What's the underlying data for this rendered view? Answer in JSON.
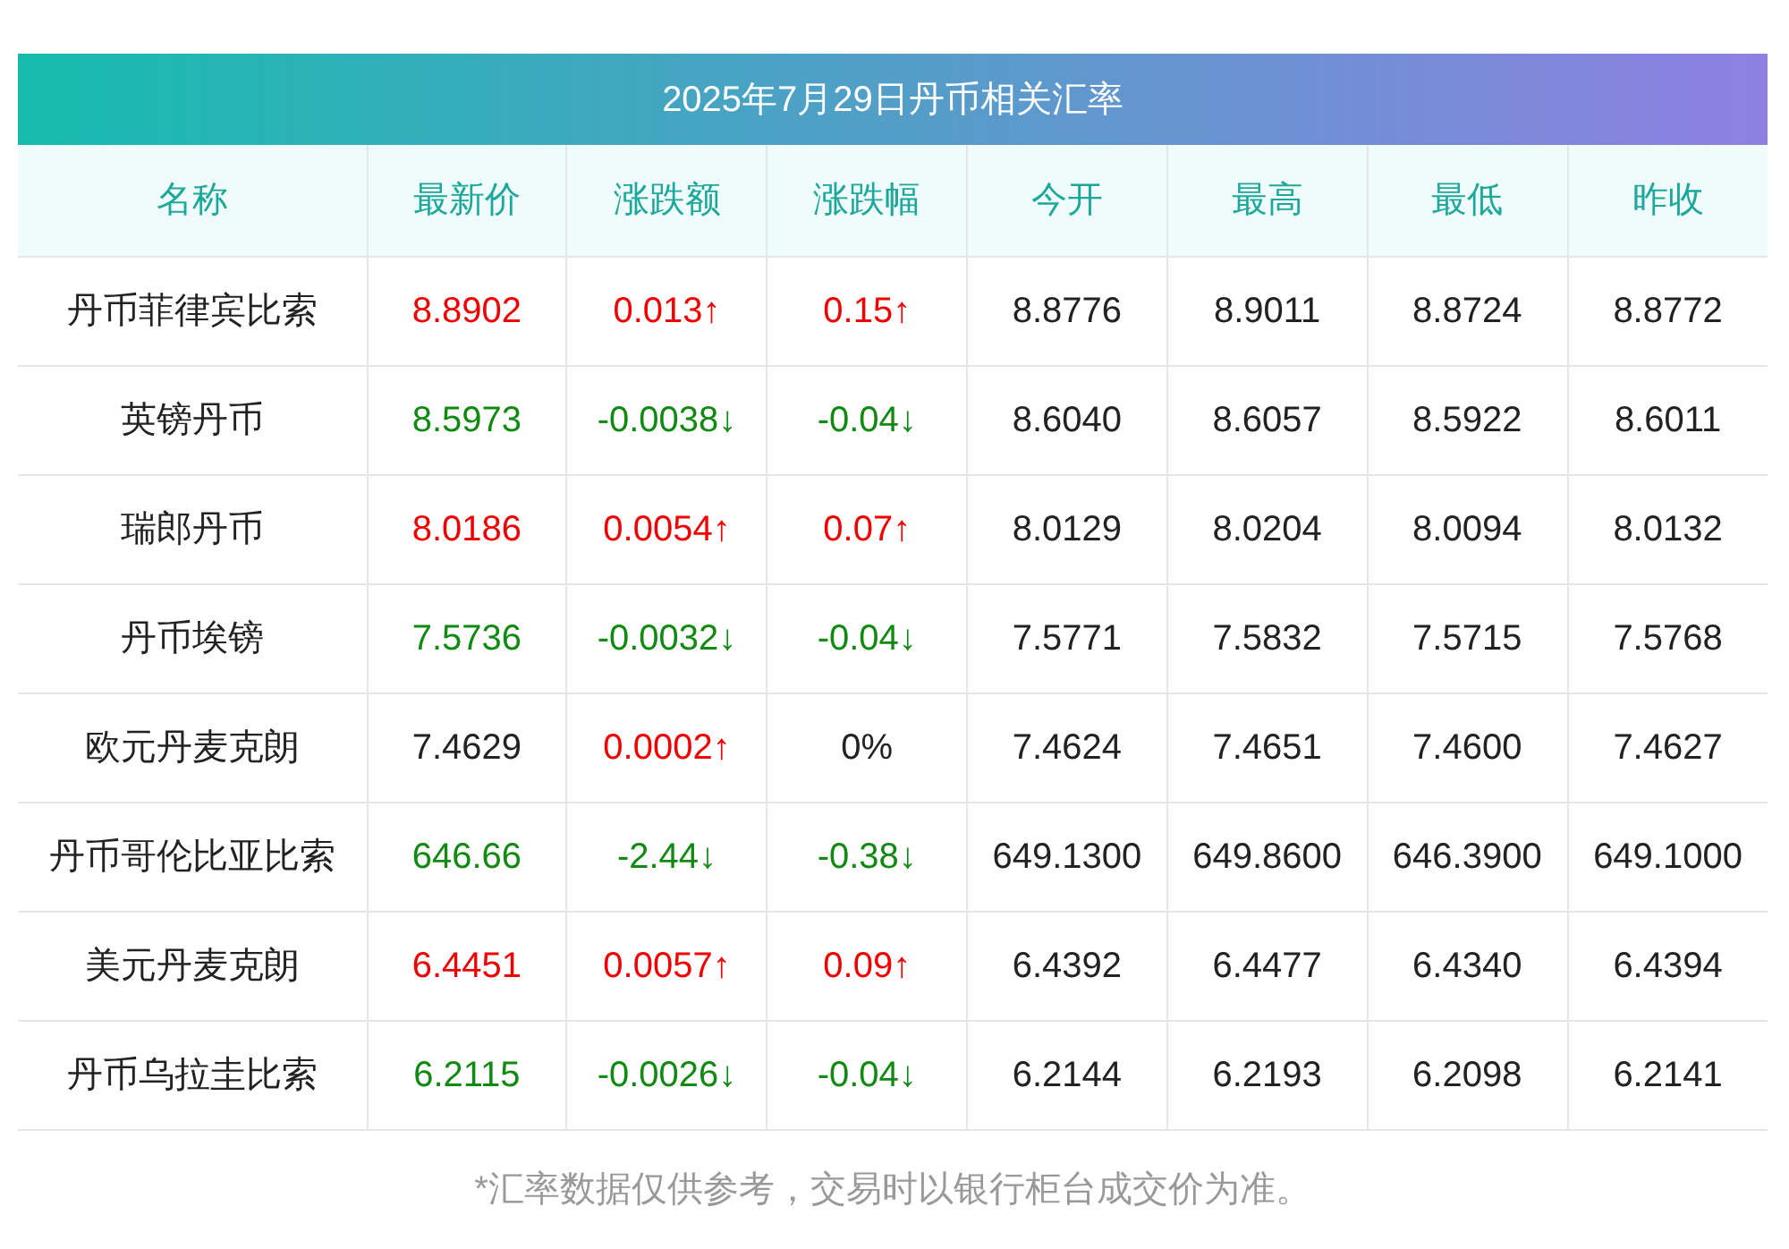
{
  "title": "2025年7月29日丹币相关汇率",
  "columns": [
    "名称",
    "最新价",
    "涨跌额",
    "涨跌幅",
    "今开",
    "最高",
    "最低",
    "昨收"
  ],
  "rows": [
    {
      "name": "丹币菲律宾比索",
      "price": {
        "text": "8.8902",
        "kind": "up"
      },
      "change": {
        "text": "0.013↑",
        "kind": "up"
      },
      "pct": {
        "text": "0.15↑",
        "kind": "up"
      },
      "open": "8.8776",
      "high": "8.9011",
      "low": "8.8724",
      "prev_close": "8.8772"
    },
    {
      "name": "英镑丹币",
      "price": {
        "text": "8.5973",
        "kind": "down"
      },
      "change": {
        "text": "-0.0038↓",
        "kind": "down"
      },
      "pct": {
        "text": "-0.04↓",
        "kind": "down"
      },
      "open": "8.6040",
      "high": "8.6057",
      "low": "8.5922",
      "prev_close": "8.6011"
    },
    {
      "name": "瑞郎丹币",
      "price": {
        "text": "8.0186",
        "kind": "up"
      },
      "change": {
        "text": "0.0054↑",
        "kind": "up"
      },
      "pct": {
        "text": "0.07↑",
        "kind": "up"
      },
      "open": "8.0129",
      "high": "8.0204",
      "low": "8.0094",
      "prev_close": "8.0132"
    },
    {
      "name": "丹币埃镑",
      "price": {
        "text": "7.5736",
        "kind": "down"
      },
      "change": {
        "text": "-0.0032↓",
        "kind": "down"
      },
      "pct": {
        "text": "-0.04↓",
        "kind": "down"
      },
      "open": "7.5771",
      "high": "7.5832",
      "low": "7.5715",
      "prev_close": "7.5768"
    },
    {
      "name": "欧元丹麦克朗",
      "price": {
        "text": "7.4629",
        "kind": "flat"
      },
      "change": {
        "text": "0.0002↑",
        "kind": "up"
      },
      "pct": {
        "text": "0%",
        "kind": "flat"
      },
      "open": "7.4624",
      "high": "7.4651",
      "low": "7.4600",
      "prev_close": "7.4627"
    },
    {
      "name": "丹币哥伦比亚比索",
      "price": {
        "text": "646.66",
        "kind": "down"
      },
      "change": {
        "text": "-2.44↓",
        "kind": "down"
      },
      "pct": {
        "text": "-0.38↓",
        "kind": "down"
      },
      "open": "649.1300",
      "high": "649.8600",
      "low": "646.3900",
      "prev_close": "649.1000"
    },
    {
      "name": "美元丹麦克朗",
      "price": {
        "text": "6.4451",
        "kind": "up"
      },
      "change": {
        "text": "0.0057↑",
        "kind": "up"
      },
      "pct": {
        "text": "0.09↑",
        "kind": "up"
      },
      "open": "6.4392",
      "high": "6.4477",
      "low": "6.4340",
      "prev_close": "6.4394"
    },
    {
      "name": "丹币乌拉圭比索",
      "price": {
        "text": "6.2115",
        "kind": "down"
      },
      "change": {
        "text": "-0.0026↓",
        "kind": "down"
      },
      "pct": {
        "text": "-0.04↓",
        "kind": "down"
      },
      "open": "6.2144",
      "high": "6.2193",
      "low": "6.2098",
      "prev_close": "6.2141"
    }
  ],
  "footnote": "*汇率数据仅供参考，交易时以银行柜台成交价为准。"
}
